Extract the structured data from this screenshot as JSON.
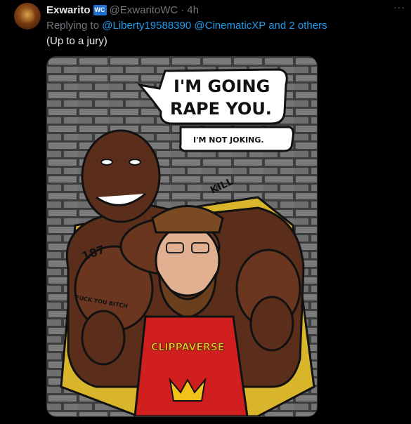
{
  "tweet": {
    "author_name": "Exwarito",
    "badge": "WC",
    "handle": "@ExwaritoWC",
    "separator": "·",
    "time": "4h",
    "more": "···",
    "reply_prefix": "Replying to",
    "reply_user1": "@Liberty19588390",
    "reply_user2": "@CinematicXP",
    "reply_suffix": "and 2 others",
    "text": "(Up to a jury)"
  },
  "image": {
    "speech_line1": "I'M GOING",
    "speech_line2": "RAPE YOU.",
    "speech_small": "I'M NOT JOKING.",
    "tattoo_187": "187",
    "tattoo_kill": "KILL",
    "tattoo_arm": "FUCK YOU BITCH",
    "shirt_text": "CLIPPAVERSE"
  },
  "colors": {
    "background": "#000000",
    "text": "#e7e9ea",
    "muted": "#71767b",
    "link": "#1d9bf0",
    "badge": "#1d6fd1"
  }
}
